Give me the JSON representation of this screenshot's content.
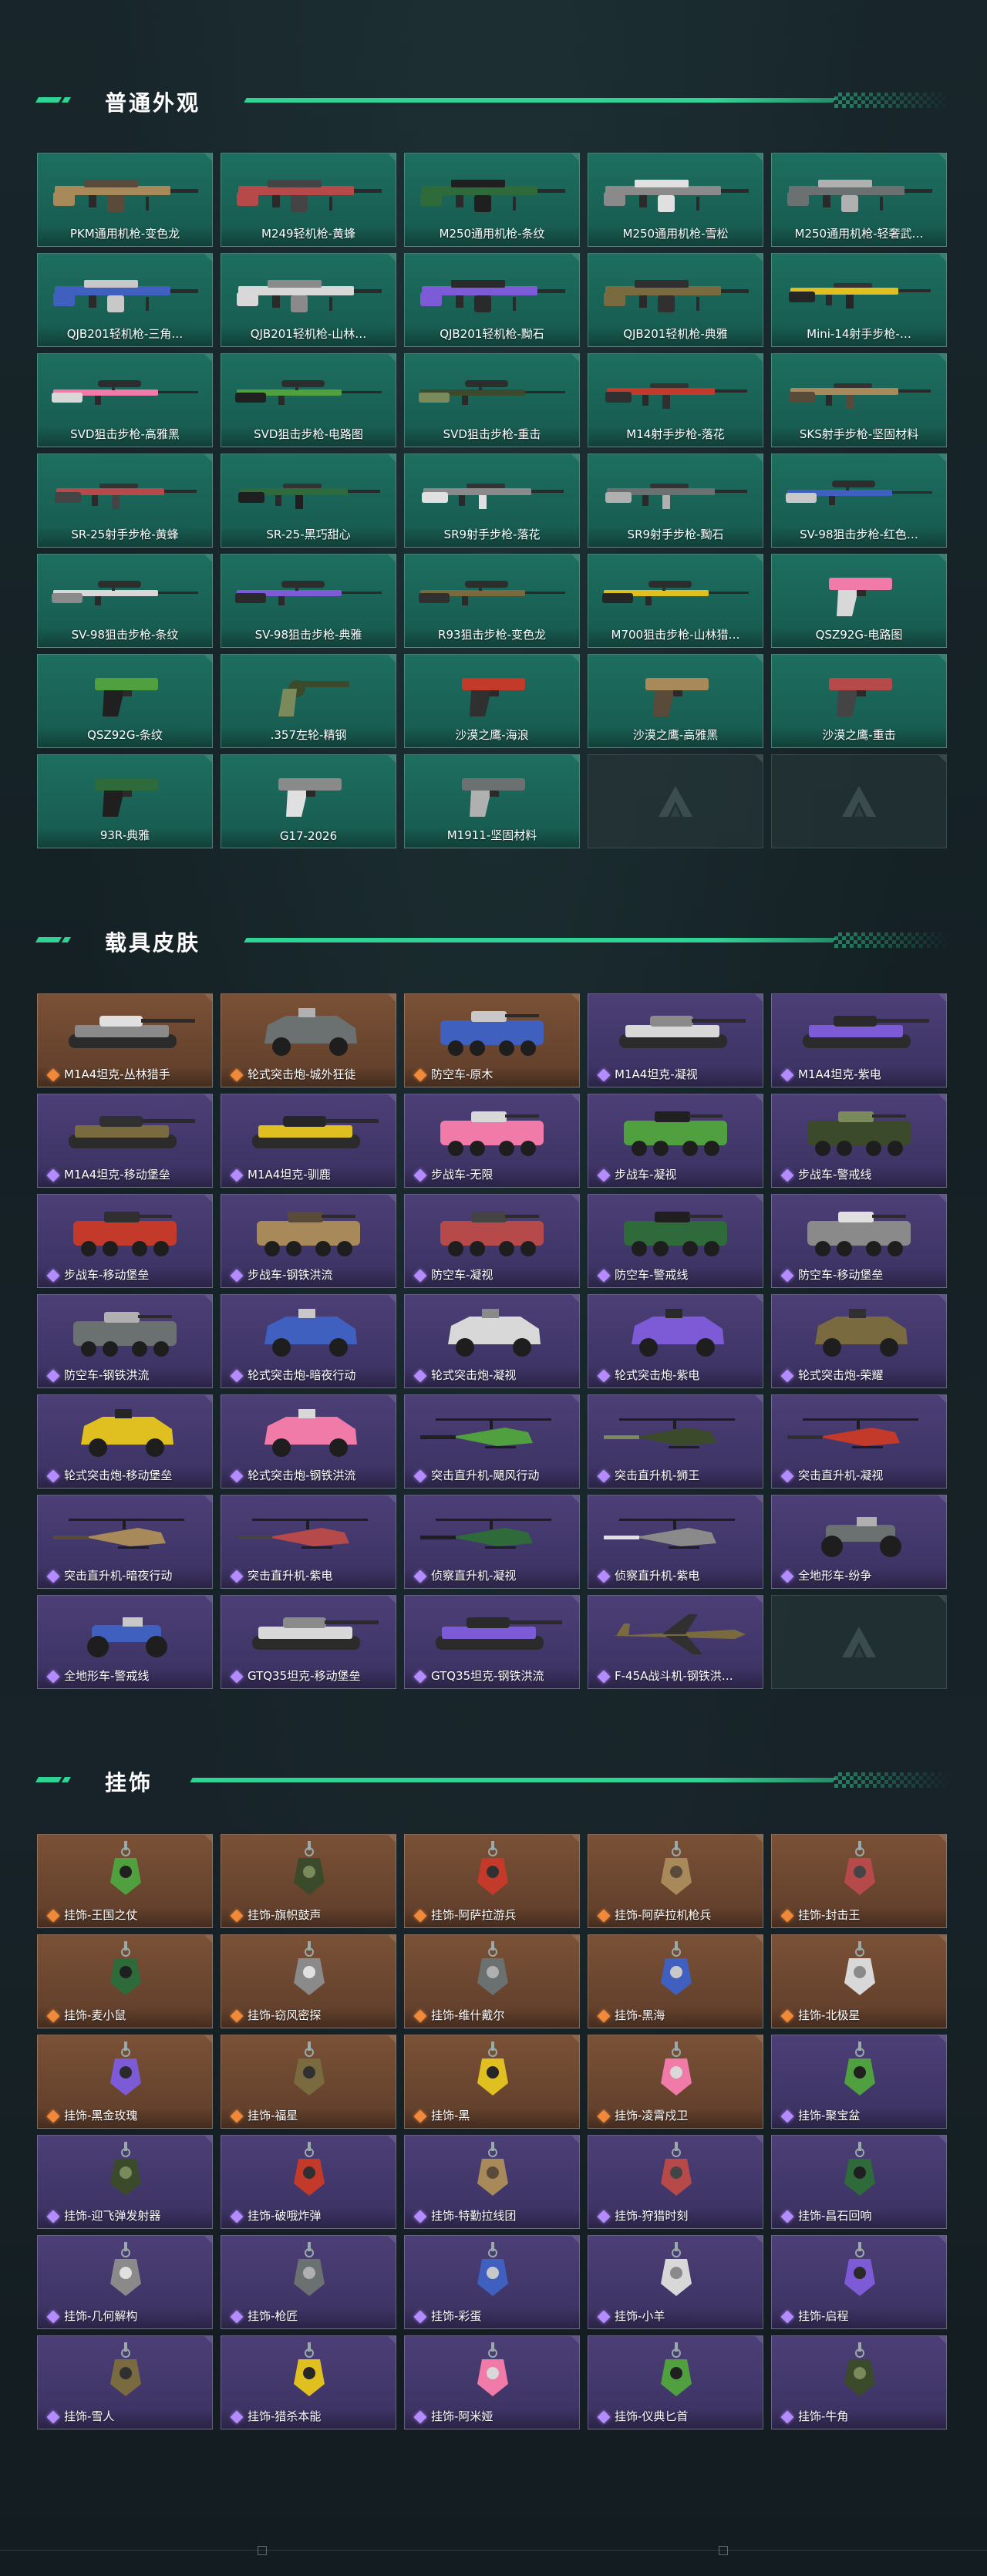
{
  "colors": {
    "accent": "#2fd394",
    "green_card": "#1d6f60",
    "orange_card": "#7a5136",
    "purple_card": "#4c3f77"
  },
  "sections": {
    "weapons": {
      "title": "普通外观",
      "items": [
        {
          "label": "PKM通用机枪-变色龙",
          "tone": "green",
          "icon": "machine-gun-icon"
        },
        {
          "label": "M249轻机枪-黄蜂",
          "tone": "green",
          "icon": "machine-gun-icon"
        },
        {
          "label": "M250通用机枪-条纹",
          "tone": "green",
          "icon": "machine-gun-icon"
        },
        {
          "label": "M250通用机枪-雪松",
          "tone": "green",
          "icon": "machine-gun-icon"
        },
        {
          "label": "M250通用机枪-轻奢武…",
          "tone": "green",
          "icon": "machine-gun-icon"
        },
        {
          "label": "QJB201轻机枪-三角…",
          "tone": "green",
          "icon": "machine-gun-icon"
        },
        {
          "label": "QJB201轻机枪-山林…",
          "tone": "green",
          "icon": "machine-gun-icon"
        },
        {
          "label": "QJB201轻机枪-黝石",
          "tone": "green",
          "icon": "machine-gun-icon"
        },
        {
          "label": "QJB201轻机枪-典雅",
          "tone": "green",
          "icon": "machine-gun-icon"
        },
        {
          "label": "Mini-14射手步枪-…",
          "tone": "green",
          "icon": "rifle-icon"
        },
        {
          "label": "SVD狙击步枪-高雅黑",
          "tone": "green",
          "icon": "sniper-rifle-icon"
        },
        {
          "label": "SVD狙击步枪-电路图",
          "tone": "green",
          "icon": "sniper-rifle-icon"
        },
        {
          "label": "SVD狙击步枪-重击",
          "tone": "green",
          "icon": "sniper-rifle-icon"
        },
        {
          "label": "M14射手步枪-落花",
          "tone": "green",
          "icon": "rifle-icon"
        },
        {
          "label": "SKS射手步枪-坚固材料",
          "tone": "green",
          "icon": "rifle-icon"
        },
        {
          "label": "SR-25射手步枪-黄蜂",
          "tone": "green",
          "icon": "rifle-icon"
        },
        {
          "label": "SR-25-黑巧甜心",
          "tone": "green",
          "icon": "rifle-icon"
        },
        {
          "label": "SR9射手步枪-落花",
          "tone": "green",
          "icon": "rifle-icon"
        },
        {
          "label": "SR9射手步枪-黝石",
          "tone": "green",
          "icon": "rifle-icon"
        },
        {
          "label": "SV-98狙击步枪-红色…",
          "tone": "green",
          "icon": "sniper-rifle-icon"
        },
        {
          "label": "SV-98狙击步枪-条纹",
          "tone": "green",
          "icon": "sniper-rifle-icon"
        },
        {
          "label": "SV-98狙击步枪-典雅",
          "tone": "green",
          "icon": "sniper-rifle-icon"
        },
        {
          "label": "R93狙击步枪-变色龙",
          "tone": "green",
          "icon": "sniper-rifle-icon"
        },
        {
          "label": "M700狙击步枪-山林猎…",
          "tone": "green",
          "icon": "sniper-rifle-icon"
        },
        {
          "label": "QSZ92G-电路图",
          "tone": "green",
          "icon": "pistol-icon"
        },
        {
          "label": "QSZ92G-条纹",
          "tone": "green",
          "icon": "pistol-icon"
        },
        {
          "label": ".357左轮-精钢",
          "tone": "green",
          "icon": "revolver-icon"
        },
        {
          "label": "沙漠之鹰-海浪",
          "tone": "green",
          "icon": "pistol-icon"
        },
        {
          "label": "沙漠之鹰-高雅黑",
          "tone": "green",
          "icon": "pistol-icon"
        },
        {
          "label": "沙漠之鹰-重击",
          "tone": "green",
          "icon": "pistol-icon"
        },
        {
          "label": "93R-典雅",
          "tone": "green",
          "icon": "pistol-icon"
        },
        {
          "label": "G17-2026",
          "tone": "green",
          "icon": "pistol-icon"
        },
        {
          "label": "M1911-坚固材料",
          "tone": "green",
          "icon": "pistol-icon"
        },
        {
          "label": "",
          "tone": "empty",
          "icon": "placeholder-logo-icon"
        },
        {
          "label": "",
          "tone": "empty",
          "icon": "placeholder-logo-icon"
        }
      ]
    },
    "vehicles": {
      "title": "载具皮肤",
      "items": [
        {
          "label": "M1A4坦克-丛林猎手",
          "tone": "orange",
          "icon": "tank-icon"
        },
        {
          "label": "轮式突击炮-城外狂徒",
          "tone": "orange",
          "icon": "armored-car-icon"
        },
        {
          "label": "防空车-原木",
          "tone": "orange",
          "icon": "apc-icon"
        },
        {
          "label": "M1A4坦克-凝视",
          "tone": "purple",
          "icon": "tank-icon"
        },
        {
          "label": "M1A4坦克-紫电",
          "tone": "purple",
          "icon": "tank-icon"
        },
        {
          "label": "M1A4坦克-移动堡垒",
          "tone": "purple",
          "icon": "tank-icon"
        },
        {
          "label": "M1A4坦克-驯鹿",
          "tone": "purple",
          "icon": "tank-icon"
        },
        {
          "label": "步战车-无限",
          "tone": "purple",
          "icon": "apc-icon"
        },
        {
          "label": "步战车-凝视",
          "tone": "purple",
          "icon": "apc-icon"
        },
        {
          "label": "步战车-警戒线",
          "tone": "purple",
          "icon": "apc-icon"
        },
        {
          "label": "步战车-移动堡垒",
          "tone": "purple",
          "icon": "apc-icon"
        },
        {
          "label": "步战车-钢铁洪流",
          "tone": "purple",
          "icon": "apc-icon"
        },
        {
          "label": "防空车-凝视",
          "tone": "purple",
          "icon": "apc-icon"
        },
        {
          "label": "防空车-警戒线",
          "tone": "purple",
          "icon": "apc-icon"
        },
        {
          "label": "防空车-移动堡垒",
          "tone": "purple",
          "icon": "apc-icon"
        },
        {
          "label": "防空车-钢铁洪流",
          "tone": "purple",
          "icon": "apc-icon"
        },
        {
          "label": "轮式突击炮-暗夜行动",
          "tone": "purple",
          "icon": "armored-car-icon"
        },
        {
          "label": "轮式突击炮-凝视",
          "tone": "purple",
          "icon": "armored-car-icon"
        },
        {
          "label": "轮式突击炮-紫电",
          "tone": "purple",
          "icon": "armored-car-icon"
        },
        {
          "label": "轮式突击炮-荣耀",
          "tone": "purple",
          "icon": "armored-car-icon"
        },
        {
          "label": "轮式突击炮-移动堡垒",
          "tone": "purple",
          "icon": "armored-car-icon"
        },
        {
          "label": "轮式突击炮-钢铁洪流",
          "tone": "purple",
          "icon": "armored-car-icon"
        },
        {
          "label": "突击直升机-飓风行动",
          "tone": "purple",
          "icon": "helicopter-icon"
        },
        {
          "label": "突击直升机-狮王",
          "tone": "purple",
          "icon": "helicopter-icon"
        },
        {
          "label": "突击直升机-凝视",
          "tone": "purple",
          "icon": "helicopter-icon"
        },
        {
          "label": "突击直升机-暗夜行动",
          "tone": "purple",
          "icon": "helicopter-icon"
        },
        {
          "label": "突击直升机-紫电",
          "tone": "purple",
          "icon": "helicopter-icon"
        },
        {
          "label": "侦察直升机-凝视",
          "tone": "purple",
          "icon": "helicopter-icon"
        },
        {
          "label": "侦察直升机-紫电",
          "tone": "purple",
          "icon": "helicopter-icon"
        },
        {
          "label": "全地形车-纷争",
          "tone": "purple",
          "icon": "atv-icon"
        },
        {
          "label": "全地形车-警戒线",
          "tone": "purple",
          "icon": "atv-icon"
        },
        {
          "label": "GTQ35坦克-移动堡垒",
          "tone": "purple",
          "icon": "tank-icon"
        },
        {
          "label": "GTQ35坦克-钢铁洪流",
          "tone": "purple",
          "icon": "tank-icon"
        },
        {
          "label": "F-45A战斗机-钢铁洪…",
          "tone": "purple",
          "icon": "jet-icon"
        },
        {
          "label": "",
          "tone": "empty",
          "icon": "placeholder-logo-icon"
        }
      ]
    },
    "charms": {
      "title": "挂饰",
      "items": [
        {
          "label": "挂饰-王国之仗",
          "tone": "orange",
          "icon": "charm-icon"
        },
        {
          "label": "挂饰-旗帜鼓声",
          "tone": "orange",
          "icon": "charm-icon"
        },
        {
          "label": "挂饰-阿萨拉游兵",
          "tone": "orange",
          "icon": "charm-icon"
        },
        {
          "label": "挂饰-阿萨拉机枪兵",
          "tone": "orange",
          "icon": "charm-icon"
        },
        {
          "label": "挂饰-封击王",
          "tone": "orange",
          "icon": "charm-icon"
        },
        {
          "label": "挂饰-麦小鼠",
          "tone": "orange",
          "icon": "charm-icon"
        },
        {
          "label": "挂饰-窃风密探",
          "tone": "orange",
          "icon": "charm-icon"
        },
        {
          "label": "挂饰-维什戴尔",
          "tone": "orange",
          "icon": "charm-icon"
        },
        {
          "label": "挂饰-黑海",
          "tone": "orange",
          "icon": "charm-icon"
        },
        {
          "label": "挂饰-北极星",
          "tone": "orange",
          "icon": "charm-icon"
        },
        {
          "label": "挂饰-黑金玫瑰",
          "tone": "orange",
          "icon": "charm-icon"
        },
        {
          "label": "挂饰-福星",
          "tone": "orange",
          "icon": "charm-icon"
        },
        {
          "label": "挂饰-黑",
          "tone": "orange",
          "icon": "charm-icon"
        },
        {
          "label": "挂饰-凌霄戍卫",
          "tone": "orange",
          "icon": "charm-icon"
        },
        {
          "label": "挂饰-聚宝盆",
          "tone": "purple",
          "icon": "charm-icon"
        },
        {
          "label": "挂饰-迎飞弹发射器",
          "tone": "purple",
          "icon": "charm-icon"
        },
        {
          "label": "挂饰-破哦炸弹",
          "tone": "purple",
          "icon": "charm-icon"
        },
        {
          "label": "挂饰-特勤拉线团",
          "tone": "purple",
          "icon": "charm-icon"
        },
        {
          "label": "挂饰-狩猎时刻",
          "tone": "purple",
          "icon": "charm-icon"
        },
        {
          "label": "挂饰-昌石回响",
          "tone": "purple",
          "icon": "charm-icon"
        },
        {
          "label": "挂饰-几何解构",
          "tone": "purple",
          "icon": "charm-icon"
        },
        {
          "label": "挂饰-枪匠",
          "tone": "purple",
          "icon": "charm-icon"
        },
        {
          "label": "挂饰-彩蛋",
          "tone": "purple",
          "icon": "charm-icon"
        },
        {
          "label": "挂饰-小羊",
          "tone": "purple",
          "icon": "charm-icon"
        },
        {
          "label": "挂饰-启程",
          "tone": "purple",
          "icon": "charm-icon"
        },
        {
          "label": "挂饰-雪人",
          "tone": "purple",
          "icon": "charm-icon"
        },
        {
          "label": "挂饰-猎杀本能",
          "tone": "purple",
          "icon": "charm-icon"
        },
        {
          "label": "挂饰-阿米娅",
          "tone": "purple",
          "icon": "charm-icon"
        },
        {
          "label": "挂饰-仪典匕首",
          "tone": "purple",
          "icon": "charm-icon"
        },
        {
          "label": "挂饰-牛角",
          "tone": "purple",
          "icon": "charm-icon"
        }
      ]
    }
  }
}
